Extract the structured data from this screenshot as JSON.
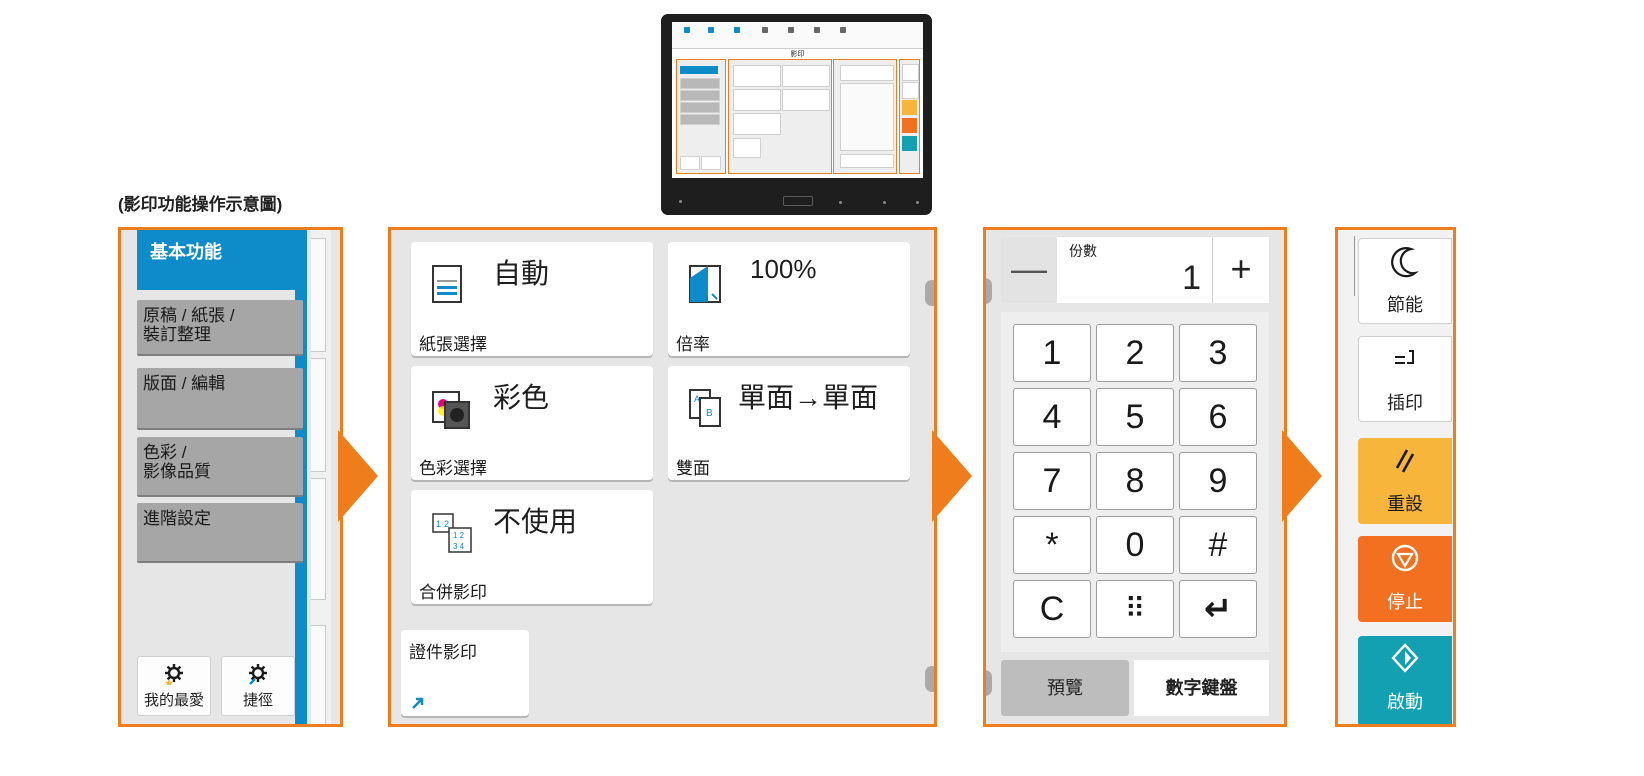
{
  "caption": "(影印功能操作示意圖)",
  "device": {
    "title": "影印"
  },
  "nav": {
    "active": "基本功能",
    "items": [
      {
        "lines": [
          "原稿 / 紙張 /",
          "裝訂整理"
        ]
      },
      {
        "lines": [
          "版面 / 編輯"
        ]
      },
      {
        "lines": [
          "色彩 /",
          "影像品質"
        ]
      },
      {
        "lines": [
          "進階設定"
        ]
      }
    ],
    "favorites_label": "我的最愛",
    "shortcut_label": "捷徑"
  },
  "functions": {
    "paper": {
      "value": "自動",
      "label": "紙張選擇"
    },
    "zoom": {
      "value": "100%",
      "label": "倍率"
    },
    "color": {
      "value": "彩色",
      "label": "色彩選擇"
    },
    "duplex": {
      "value": "單面→單面",
      "label": "雙面"
    },
    "combine": {
      "value": "不使用",
      "label": "合併影印"
    },
    "id_copy": {
      "label": "證件影印"
    }
  },
  "counter": {
    "label": "份數",
    "value": "1",
    "minus": "—",
    "plus": "+"
  },
  "keypad": {
    "keys": [
      "1",
      "2",
      "3",
      "4",
      "5",
      "6",
      "7",
      "8",
      "9",
      "*",
      "0",
      "#",
      "C",
      "⠿",
      "↵"
    ]
  },
  "keypad_footer": {
    "preview": "預覽",
    "numeric": "數字鍵盤"
  },
  "side_buttons": {
    "energy_saver": "節能",
    "interrupt": "插印",
    "reset": "重設",
    "stop": "停止",
    "start": "啟動"
  },
  "colors": {
    "accent_orange": "#ef7d1b",
    "nav_blue": "#0e8bc9",
    "reset_yellow": "#f7b53b",
    "stop_orange": "#f37021",
    "start_teal": "#12a0b2"
  }
}
